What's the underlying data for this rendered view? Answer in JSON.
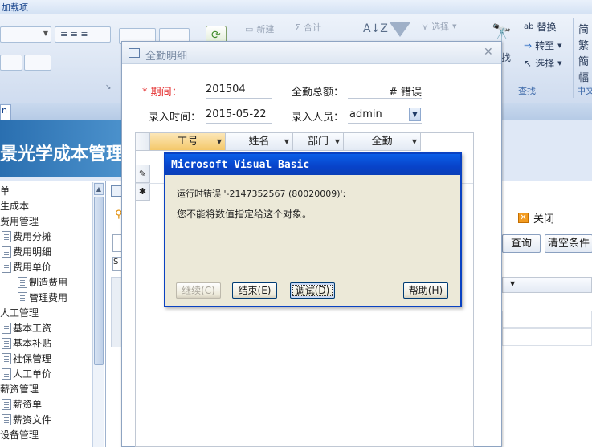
{
  "ribbon": {
    "addon_label": "加载项",
    "new_label": "新建",
    "total_label": "合计",
    "select_label": "选择",
    "replace_label": "替换",
    "goto_label": "转至",
    "select2_label": "选择",
    "find_small": "找",
    "find_group": "查找",
    "zh_group": "中文",
    "right_edge": "简 繁 簡 幅"
  },
  "tab": {
    "label": "n"
  },
  "banner": {
    "text": "景光学成本管理"
  },
  "nav": {
    "items": [
      {
        "label": "单"
      },
      {
        "label": "生成本"
      },
      {
        "label": "费用管理"
      },
      {
        "label": "费用分摊"
      },
      {
        "label": "费用明细"
      },
      {
        "label": "费用单价"
      },
      {
        "label": "制造费用"
      },
      {
        "label": "管理费用"
      },
      {
        "label": "人工管理"
      },
      {
        "label": "基本工资"
      },
      {
        "label": "基本补贴"
      },
      {
        "label": "社保管理"
      },
      {
        "label": "人工单价"
      },
      {
        "label": "薪资管理"
      },
      {
        "label": "薪资单"
      },
      {
        "label": "薪资文件"
      },
      {
        "label": "设备管理"
      }
    ]
  },
  "rightpane": {
    "close_label": "关闭",
    "query_label": "查询",
    "clear_label": "清空条件"
  },
  "window": {
    "title": "全勤明细",
    "period_label": "期间：",
    "period_value": "201504",
    "total_label": "全勤总额：",
    "total_value": "# 错误",
    "entry_time_label": "录入时间：",
    "entry_time_value": "2015-05-22",
    "entry_user_label": "录入人员：",
    "entry_user_value": "admin",
    "columns": [
      "工号",
      "姓名",
      "部门",
      "全勤"
    ]
  },
  "dialog": {
    "title": "Microsoft Visual Basic",
    "message1": "运行时错误 '-2147352567 (80020009)':",
    "message2": "您不能将数值指定给这个对象。",
    "continue_label": "继续(C)",
    "end_label": "结束(E)",
    "debug_label": "调试(D)",
    "help_label": "帮助(H)"
  }
}
